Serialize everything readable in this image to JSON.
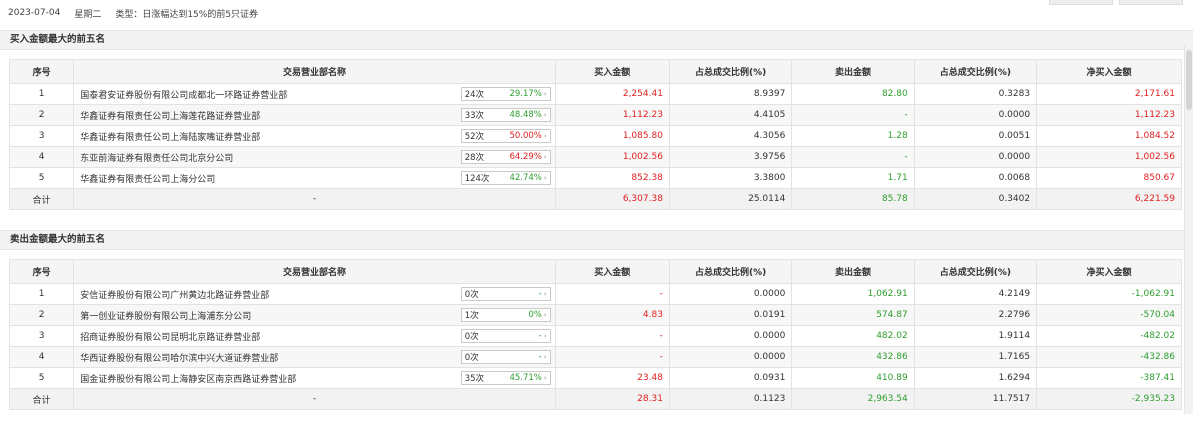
{
  "header": {
    "date": "2023-07-04",
    "weekday": "星期二",
    "type_label": "类型：日涨幅达到15%的前5只证券"
  },
  "buy_section": {
    "title": "买入金额最大的前五名",
    "columns": [
      "序号",
      "交易营业部名称",
      "买入金额",
      "占总成交比例(%)",
      "卖出金额",
      "占总成交比例(%)",
      "净买入金额"
    ],
    "rows": [
      {
        "no": "1",
        "name": "国泰君安证券股份有限公司成都北一环路证券营业部",
        "count": "24次",
        "pct": "29.17%",
        "buy": "2,254.41",
        "buy_ratio": "8.9397",
        "sell": "82.80",
        "sell_ratio": "0.3283",
        "net": "2,171.61"
      },
      {
        "no": "2",
        "name": "华鑫证券有限责任公司上海莲花路证券营业部",
        "count": "33次",
        "pct": "48.48%",
        "buy": "1,112.23",
        "buy_ratio": "4.4105",
        "sell": "-",
        "sell_ratio": "0.0000",
        "net": "1,112.23"
      },
      {
        "no": "3",
        "name": "华鑫证券有限责任公司上海陆家嘴证券营业部",
        "count": "52次",
        "pct": "50.00%",
        "buy": "1,085.80",
        "buy_ratio": "4.3056",
        "sell": "1.28",
        "sell_ratio": "0.0051",
        "net": "1,084.52"
      },
      {
        "no": "4",
        "name": "东亚前海证券有限责任公司北京分公司",
        "count": "28次",
        "pct": "64.29%",
        "buy": "1,002.56",
        "buy_ratio": "3.9756",
        "sell": "-",
        "sell_ratio": "0.0000",
        "net": "1,002.56"
      },
      {
        "no": "5",
        "name": "华鑫证券有限责任公司上海分公司",
        "count": "124次",
        "pct": "42.74%",
        "buy": "852.38",
        "buy_ratio": "3.3800",
        "sell": "1.71",
        "sell_ratio": "0.0068",
        "net": "850.67"
      }
    ],
    "total": {
      "label": "合计",
      "name": "-",
      "buy": "6,307.38",
      "buy_ratio": "25.0114",
      "sell": "85.78",
      "sell_ratio": "0.3402",
      "net": "6,221.59"
    }
  },
  "sell_section": {
    "title": "卖出金额最大的前五名",
    "columns": [
      "序号",
      "交易营业部名称",
      "买入金额",
      "占总成交比例(%)",
      "卖出金额",
      "占总成交比例(%)",
      "净买入金额"
    ],
    "rows": [
      {
        "no": "1",
        "name": "安信证券股份有限公司广州黄边北路证券营业部",
        "count": "0次",
        "pct": "-",
        "buy": "-",
        "buy_ratio": "0.0000",
        "sell": "1,062.91",
        "sell_ratio": "4.2149",
        "net": "-1,062.91"
      },
      {
        "no": "2",
        "name": "第一创业证券股份有限公司上海浦东分公司",
        "count": "1次",
        "pct": "0%",
        "buy": "4.83",
        "buy_ratio": "0.0191",
        "sell": "574.87",
        "sell_ratio": "2.2796",
        "net": "-570.04"
      },
      {
        "no": "3",
        "name": "招商证券股份有限公司昆明北京路证券营业部",
        "count": "0次",
        "pct": "-",
        "buy": "-",
        "buy_ratio": "0.0000",
        "sell": "482.02",
        "sell_ratio": "1.9114",
        "net": "-482.02"
      },
      {
        "no": "4",
        "name": "华西证券股份有限公司哈尔滨中兴大道证券营业部",
        "count": "0次",
        "pct": "-",
        "buy": "-",
        "buy_ratio": "0.0000",
        "sell": "432.86",
        "sell_ratio": "1.7165",
        "net": "-432.86"
      },
      {
        "no": "5",
        "name": "国金证券股份有限公司上海静安区南京西路证券营业部",
        "count": "35次",
        "pct": "45.71%",
        "buy": "23.48",
        "buy_ratio": "0.0931",
        "sell": "410.89",
        "sell_ratio": "1.6294",
        "net": "-387.41"
      }
    ],
    "total": {
      "label": "合计",
      "name": "-",
      "buy": "28.31",
      "buy_ratio": "0.1123",
      "sell": "2,963.54",
      "sell_ratio": "11.7517",
      "net": "-2,935.23"
    }
  },
  "colors": {
    "positive": "#e02020",
    "negative": "#2e9e2e"
  },
  "icons": {
    "badge_arrow": "chevron-right-icon"
  }
}
